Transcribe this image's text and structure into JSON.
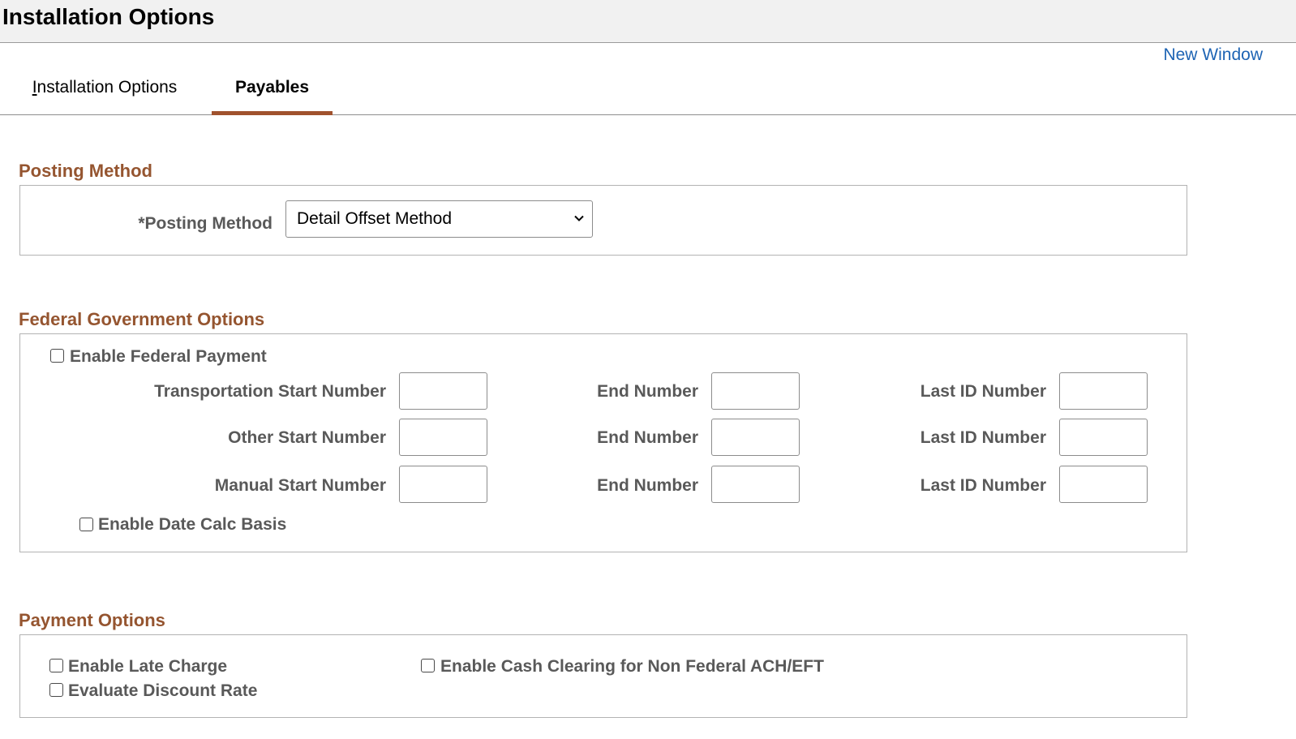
{
  "header": {
    "title": "Installation Options",
    "new_window": "New Window"
  },
  "tabs": [
    {
      "label_first": "I",
      "label_rest": "nstallation Options"
    },
    {
      "label": "Payables"
    }
  ],
  "posting": {
    "section_title": "Posting Method",
    "field_label": "*Posting Method",
    "selected_value": "Detail Offset Method"
  },
  "federal": {
    "section_title": "Federal Government Options",
    "enable_federal_payment": "Enable Federal Payment",
    "rows": [
      {
        "start_label": "Transportation Start Number",
        "end_label": "End Number",
        "last_label": "Last ID Number"
      },
      {
        "start_label": "Other Start Number",
        "end_label": "End Number",
        "last_label": "Last ID Number"
      },
      {
        "start_label": "Manual Start Number",
        "end_label": "End Number",
        "last_label": "Last ID Number"
      }
    ],
    "enable_date_calc_basis": "Enable Date Calc Basis"
  },
  "payment": {
    "section_title": "Payment Options",
    "enable_late_charge": "Enable Late Charge",
    "evaluate_discount_rate": "Evaluate Discount Rate",
    "enable_cash_clearing": "Enable Cash Clearing for Non Federal ACH/EFT"
  },
  "colors": {
    "accent": "#a0522d",
    "section_title": "#955530",
    "link": "#1e64b4"
  }
}
